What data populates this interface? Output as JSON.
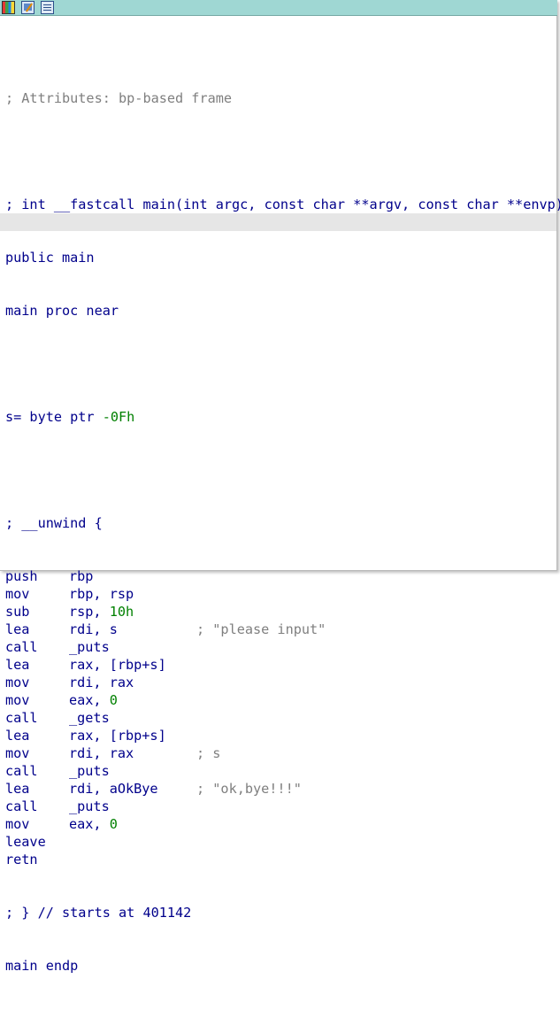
{
  "titlebar": {
    "icons": [
      "graph-icon",
      "edit-icon",
      "list-icon"
    ]
  },
  "code": {
    "attributes_comment": "; Attributes: bp-based frame",
    "signature_comment": "; int __fastcall main(int argc, const char **argv, const char **envp)",
    "public_line": "public main",
    "proc_line": "main proc near",
    "var_name": "s= byte ptr ",
    "var_offset": "-0Fh",
    "unwind_comment": "; __unwind {",
    "instructions": [
      {
        "mn": "push",
        "op": "rbp",
        "num": "",
        "cmt": ""
      },
      {
        "mn": "mov",
        "op": "rbp, rsp",
        "num": "",
        "cmt": ""
      },
      {
        "mn": "sub",
        "op": "rsp, ",
        "num": "10h",
        "cmt": ""
      },
      {
        "mn": "lea",
        "op": "rdi, s",
        "num": "",
        "cmt": "; \"please input\""
      },
      {
        "mn": "call",
        "op": "_puts",
        "num": "",
        "cmt": ""
      },
      {
        "mn": "lea",
        "op": "rax, [rbp+s]",
        "num": "",
        "cmt": ""
      },
      {
        "mn": "mov",
        "op": "rdi, rax",
        "num": "",
        "cmt": ""
      },
      {
        "mn": "mov",
        "op": "eax, ",
        "num": "0",
        "cmt": ""
      },
      {
        "mn": "call",
        "op": "_gets",
        "num": "",
        "cmt": ""
      },
      {
        "mn": "lea",
        "op": "rax, [rbp+s]",
        "num": "",
        "cmt": ""
      },
      {
        "mn": "mov",
        "op": "rdi, rax",
        "num": "",
        "cmt": "; s"
      },
      {
        "mn": "call",
        "op": "_puts",
        "num": "",
        "cmt": ""
      },
      {
        "mn": "lea",
        "op": "rdi, aOkBye",
        "num": "",
        "cmt": "; \"ok,bye!!!\""
      },
      {
        "mn": "call",
        "op": "_puts",
        "num": "",
        "cmt": ""
      },
      {
        "mn": "mov",
        "op": "eax, ",
        "num": "0",
        "cmt": ""
      },
      {
        "mn": "leave",
        "op": "",
        "num": "",
        "cmt": ""
      },
      {
        "mn": "retn",
        "op": "",
        "num": "",
        "cmt": ""
      }
    ],
    "end_unwind_comment": "; } // starts at 401142",
    "endp_line": "main endp"
  }
}
